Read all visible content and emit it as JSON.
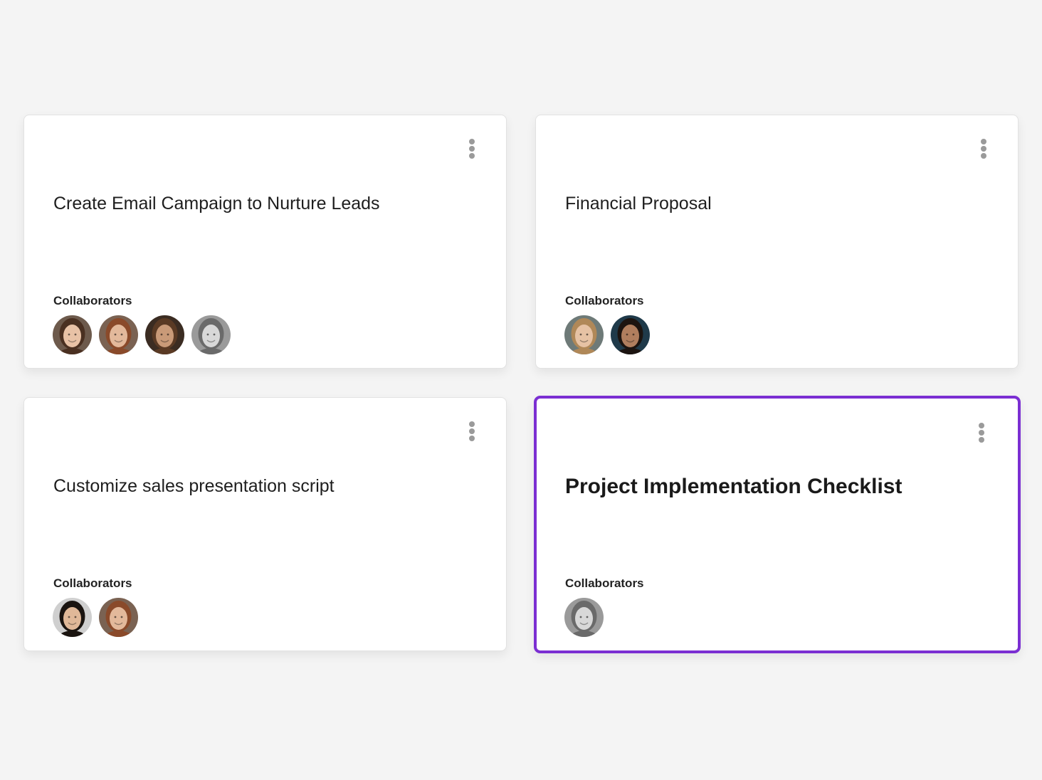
{
  "cards": [
    {
      "title": "Create Email Campaign to Nurture Leads",
      "collaborators_label": "Collaborators",
      "selected": false,
      "avatars": [
        {
          "name": "avatar-woman-smiling",
          "bg": "#6d5a4c",
          "skin": "#e8c2a6",
          "hair": "#4a3021"
        },
        {
          "name": "avatar-woman-auburn",
          "bg": "#7a6252",
          "skin": "#e3b99b",
          "hair": "#8a4a2a"
        },
        {
          "name": "avatar-man-beard",
          "bg": "#3b2c22",
          "skin": "#c99a78",
          "hair": "#5a3a24"
        },
        {
          "name": "avatar-woman-grayscale",
          "bg": "#9a9a9a",
          "skin": "#d8d8d8",
          "hair": "#6a6a6a"
        }
      ]
    },
    {
      "title": "Financial Proposal",
      "collaborators_label": "Collaborators",
      "selected": false,
      "avatars": [
        {
          "name": "avatar-woman-blonde",
          "bg": "#6e7a78",
          "skin": "#e6c2a4",
          "hair": "#b08858"
        },
        {
          "name": "avatar-man-bearded-smiling",
          "bg": "#1f3a4a",
          "skin": "#b07e5e",
          "hair": "#1c1410"
        }
      ]
    },
    {
      "title": "Customize sales presentation script",
      "collaborators_label": "Collaborators",
      "selected": false,
      "avatars": [
        {
          "name": "avatar-man-short-hair",
          "bg": "#cfcfcf",
          "skin": "#e0b898",
          "hair": "#1a1410"
        },
        {
          "name": "avatar-woman-auburn-2",
          "bg": "#7a6252",
          "skin": "#e3b99b",
          "hair": "#8a4a2a"
        }
      ]
    },
    {
      "title": "Project Implementation Checklist",
      "collaborators_label": "Collaborators",
      "selected": true,
      "avatars": [
        {
          "name": "avatar-woman-grayscale-2",
          "bg": "#9a9a9a",
          "skin": "#d8d8d8",
          "hair": "#6a6a6a"
        }
      ]
    }
  ],
  "colors": {
    "selection_border": "#7b2fd2",
    "page_background": "#f4f4f4",
    "menu_dots": "#9a9a9a"
  },
  "icons": {
    "menu": "more-vertical-icon"
  }
}
